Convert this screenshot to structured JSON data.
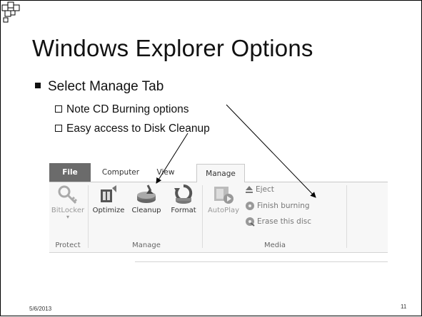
{
  "slide": {
    "title": "Windows Explorer Options",
    "bullet": "Select Manage Tab",
    "subbullets": [
      "Note CD Burning options",
      "Easy access to Disk Cleanup"
    ],
    "footer_date": "5/6/2013",
    "page_number": "11"
  },
  "ribbon": {
    "tabs": [
      "File",
      "Computer",
      "View",
      "Manage"
    ],
    "active_tab": "Manage",
    "groups": {
      "protect": {
        "label": "Protect",
        "buttons": [
          {
            "label": "BitLocker",
            "icon": "bitlocker-key-icon",
            "enabled": false
          }
        ]
      },
      "manage": {
        "label": "Manage",
        "buttons": [
          {
            "label": "Optimize",
            "icon": "optimize-drive-icon"
          },
          {
            "label": "Cleanup",
            "icon": "disk-cleanup-icon"
          },
          {
            "label": "Format",
            "icon": "format-drive-icon"
          }
        ]
      },
      "media": {
        "label": "Media",
        "big_button": {
          "label": "AutoPlay",
          "icon": "autoplay-icon",
          "enabled": false
        },
        "small_buttons": [
          {
            "label": "Eject",
            "icon": "eject-icon"
          },
          {
            "label": "Finish burning",
            "icon": "finish-burning-icon"
          },
          {
            "label": "Erase this disc",
            "icon": "erase-disc-icon"
          }
        ]
      }
    }
  },
  "colors": {
    "file_tab": "#6b6b6b",
    "ribbon_bg": "#f7f7f7",
    "text": "#111111"
  }
}
